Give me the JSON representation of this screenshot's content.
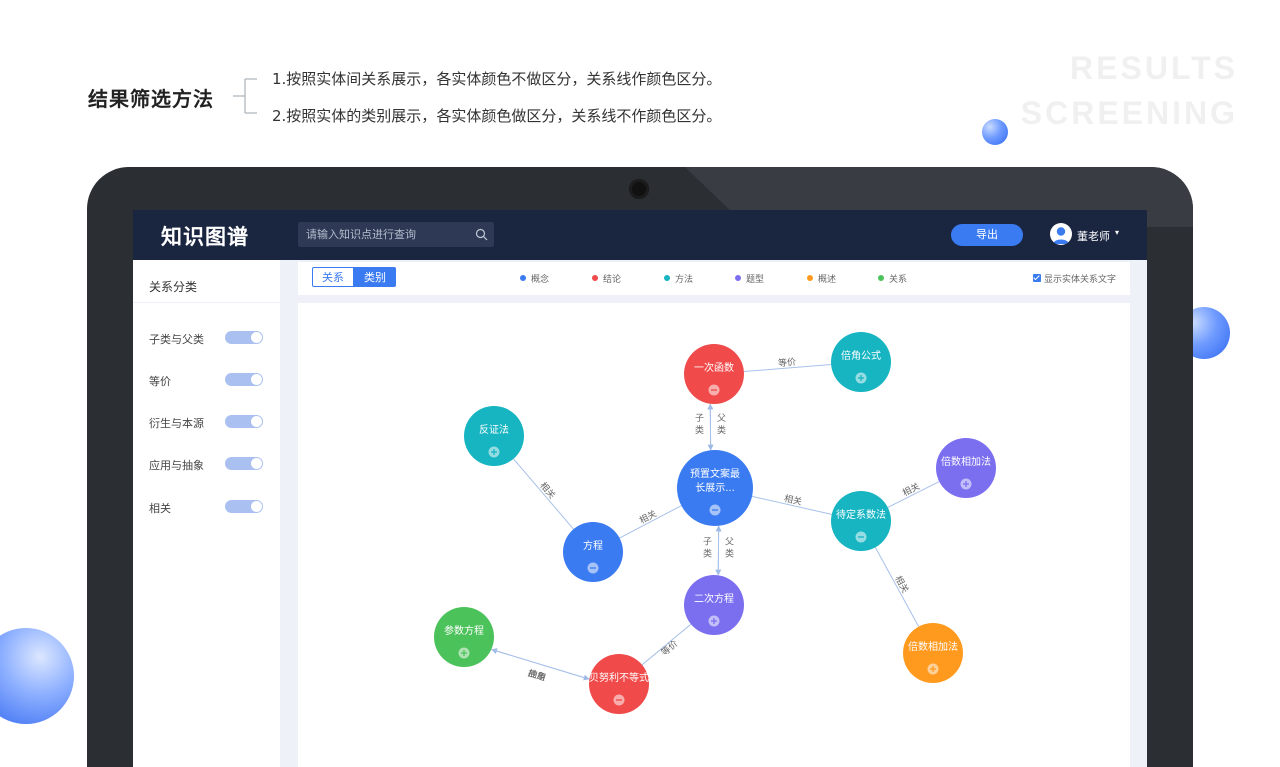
{
  "slide": {
    "title": "结果筛选方法",
    "methods": [
      "1.按照实体间关系展示，各实体颜色不做区分，关系线作颜色区分。",
      "2.按照实体的类别展示，各实体颜色做区分，关系线不作颜色区分。"
    ],
    "watermark": [
      "RESULTS",
      "SCREENING"
    ]
  },
  "app": {
    "logo": "知识图谱",
    "search_placeholder": "请输入知识点进行查询",
    "export_label": "导出",
    "user_name": "董老师",
    "user_caret": "▾"
  },
  "sidebar": {
    "title": "关系分类",
    "filters": [
      {
        "label": "子类与父类",
        "on": true
      },
      {
        "label": "等价",
        "on": true
      },
      {
        "label": "衍生与本源",
        "on": true
      },
      {
        "label": "应用与抽象",
        "on": true
      },
      {
        "label": "相关",
        "on": true
      }
    ]
  },
  "toolbar": {
    "view_modes": [
      "关系",
      "类别"
    ],
    "active_mode": "类别",
    "legend": [
      {
        "label": "概念",
        "color": "#3a7bf2"
      },
      {
        "label": "结论",
        "color": "#f04a4a"
      },
      {
        "label": "方法",
        "color": "#17b4c2"
      },
      {
        "label": "题型",
        "color": "#7b6ff0"
      },
      {
        "label": "概述",
        "color": "#ff9a1f"
      },
      {
        "label": "关系",
        "color": "#4cc25a"
      }
    ],
    "show_relation_text": "显示实体关系文字",
    "show_relation_text_checked": true
  },
  "graph": {
    "nodes": [
      {
        "id": "center",
        "label": [
          "预置文案最",
          "长展示..."
        ],
        "category": "概念",
        "state": "expanded"
      },
      {
        "id": "linear",
        "label": [
          "一次函数"
        ],
        "category": "结论",
        "state": "expanded"
      },
      {
        "id": "double",
        "label": [
          "倍角公式"
        ],
        "category": "方法",
        "state": "collapsed"
      },
      {
        "id": "contra",
        "label": [
          "反证法"
        ],
        "category": "方法",
        "state": "collapsed"
      },
      {
        "id": "equation",
        "label": [
          "方程"
        ],
        "category": "概念",
        "state": "expanded"
      },
      {
        "id": "undet",
        "label": [
          "待定系数法"
        ],
        "category": "方法",
        "state": "expanded"
      },
      {
        "id": "multadd1",
        "label": [
          "倍数相加法"
        ],
        "category": "题型",
        "state": "collapsed"
      },
      {
        "id": "quad",
        "label": [
          "二次方程"
        ],
        "category": "题型",
        "state": "collapsed"
      },
      {
        "id": "param",
        "label": [
          "参数方程"
        ],
        "category": "关系",
        "state": "collapsed"
      },
      {
        "id": "bern",
        "label": [
          "贝努利不等式"
        ],
        "category": "结论",
        "state": "expanded"
      },
      {
        "id": "multadd2",
        "label": [
          "倍数相加法"
        ],
        "category": "概述",
        "state": "collapsed"
      }
    ],
    "edges": [
      {
        "from": "linear",
        "to": "double",
        "label": "等价"
      },
      {
        "from": "center",
        "to": "linear",
        "label": "子类"
      },
      {
        "from": "linear",
        "to": "center",
        "label": "父类"
      },
      {
        "from": "contra",
        "to": "equation",
        "label": "相关"
      },
      {
        "from": "equation",
        "to": "center",
        "label": "相关"
      },
      {
        "from": "center",
        "to": "undet",
        "label": "相关"
      },
      {
        "from": "undet",
        "to": "multadd1",
        "label": "相关"
      },
      {
        "from": "undet",
        "to": "multadd2",
        "label": "相关"
      },
      {
        "from": "center",
        "to": "quad",
        "label": "子类"
      },
      {
        "from": "quad",
        "to": "center",
        "label": "父类"
      },
      {
        "from": "quad",
        "to": "bern",
        "label": "等价"
      },
      {
        "from": "bern",
        "to": "param",
        "label": "应用"
      },
      {
        "from": "param",
        "to": "bern",
        "label": "抽象"
      }
    ]
  }
}
